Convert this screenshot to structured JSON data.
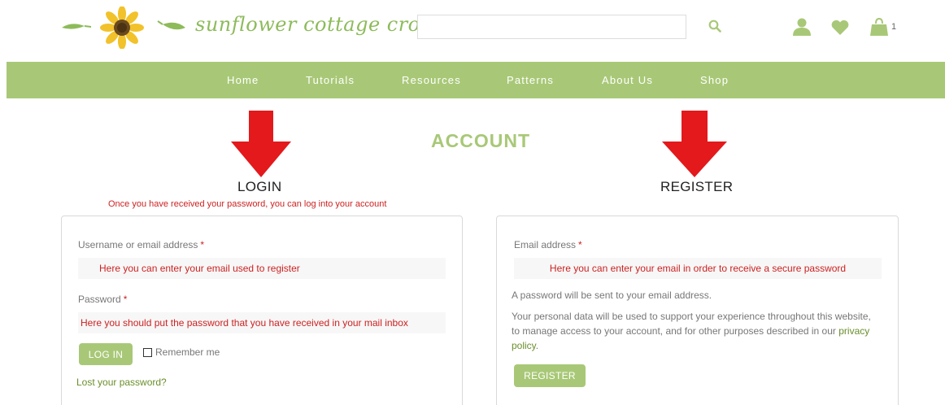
{
  "header": {
    "logo_text": "sunflower cottage crochet",
    "search": {
      "value": "",
      "placeholder": ""
    },
    "cart_count": "1",
    "icons": {
      "search": "search-icon",
      "account": "user-icon",
      "wishlist": "heart-icon",
      "cart": "shopping-bag-icon"
    }
  },
  "nav": {
    "items": [
      {
        "label": "Home"
      },
      {
        "label": "Tutorials"
      },
      {
        "label": "Resources"
      },
      {
        "label": "Patterns"
      },
      {
        "label": "About Us"
      },
      {
        "label": "Shop"
      }
    ]
  },
  "page": {
    "title": "ACCOUNT"
  },
  "login": {
    "heading": "LOGIN",
    "note": "Once you have received your password, you can log into your account",
    "username_label": "Username or email address",
    "username_value": "Here you can enter your email used to register",
    "password_label": "Password",
    "password_value": "Here you should put the password that you have received in your mail inbox",
    "button_label": "LOG IN",
    "remember_label": "Remember me",
    "lost_password_label": "Lost your password?",
    "required_mark": "*"
  },
  "register": {
    "heading": "REGISTER",
    "email_label": "Email address",
    "email_value": "Here you can enter your email in order to receive a secure password",
    "info_text": "A password will be sent to your email address.",
    "privacy_text": "Your personal data will be used to support your experience throughout this website, to manage access to your account, and for other purposes described in our",
    "privacy_link": "privacy policy",
    "privacy_end": ".",
    "button_label": "REGISTER",
    "required_mark": "*"
  },
  "colors": {
    "brand_green": "#a8c877",
    "link_green": "#6a8f2c",
    "annotation_red": "#cc2222",
    "arrow_red": "#e3191c"
  }
}
